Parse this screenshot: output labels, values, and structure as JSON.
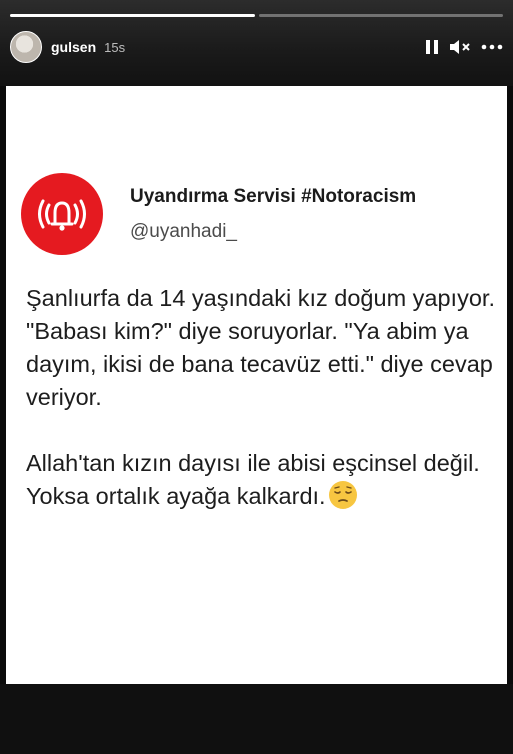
{
  "story": {
    "username": "gulsen",
    "time": "15s",
    "progress": [
      1,
      0
    ]
  },
  "tweet": {
    "display_name": "Uyandırma Servisi #Notoracism",
    "handle": "@uyanhadi_",
    "paragraphs": [
      "Şanlıurfa da 14 yaşındaki kız doğum yapıyor. \"Babası kim?\" diye soruyorlar. \"Ya abim ya dayım, ikisi de bana tecavüz etti.\" diye cevap veriyor.",
      "Allah'tan kızın dayısı ile abisi eşcinsel değil.",
      "Yoksa ortalık ayağa kalkardı."
    ],
    "emoji": "pensive-face-icon"
  },
  "colors": {
    "logo_red": "#e51a20",
    "card_bg": "#ffffff"
  }
}
